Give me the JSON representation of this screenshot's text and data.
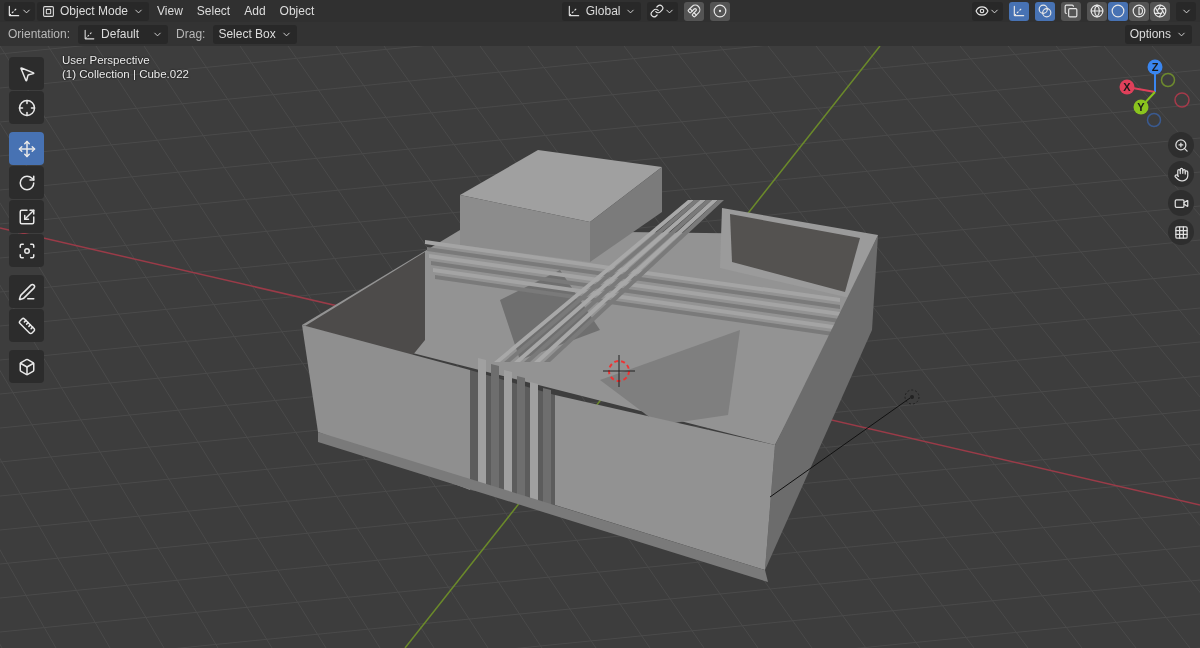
{
  "header": {
    "mode": "Object Mode",
    "menus": [
      "View",
      "Select",
      "Add",
      "Object"
    ],
    "orientation": "Global",
    "toggles": [
      {
        "kind": "snap",
        "selected": false
      },
      {
        "kind": "proportional",
        "selected": false
      }
    ],
    "view_toggles": [
      {
        "kind": "gizmos",
        "selected": true
      },
      {
        "kind": "overlays",
        "selected": true
      },
      {
        "kind": "xray",
        "selected": false
      }
    ],
    "shading": [
      {
        "kind": "wireframe",
        "selected": false
      },
      {
        "kind": "solid",
        "selected": true
      },
      {
        "kind": "material",
        "selected": false
      },
      {
        "kind": "rendered",
        "selected": false
      }
    ]
  },
  "tool_settings": {
    "orientation_label": "Orientation:",
    "orientation": "Default",
    "drag_label": "Drag:",
    "drag": "Select Box",
    "options": "Options"
  },
  "viewport": {
    "view_name": "User Perspective",
    "object_info": "(1) Collection | Cube.022"
  },
  "toolbar": [
    [
      {
        "kind": "select",
        "selected": false
      },
      {
        "kind": "cursor",
        "selected": false
      }
    ],
    [
      {
        "kind": "move",
        "selected": true
      },
      {
        "kind": "rotate",
        "selected": false
      },
      {
        "kind": "scale",
        "selected": false
      },
      {
        "kind": "transform",
        "selected": false
      }
    ],
    [
      {
        "kind": "annotate",
        "selected": false
      },
      {
        "kind": "measure",
        "selected": false
      }
    ],
    [
      {
        "kind": "add-cube",
        "selected": false
      }
    ]
  ],
  "gizmo": {
    "axes": [
      {
        "label": "Z",
        "color": "#3a86f0"
      },
      {
        "label": "X",
        "color": "#e0405a"
      },
      {
        "label": "Y",
        "color": "#8ac41e"
      }
    ]
  },
  "nav_buttons": [
    {
      "kind": "zoom"
    },
    {
      "kind": "pan"
    },
    {
      "kind": "camera"
    },
    {
      "kind": "ortho"
    }
  ]
}
